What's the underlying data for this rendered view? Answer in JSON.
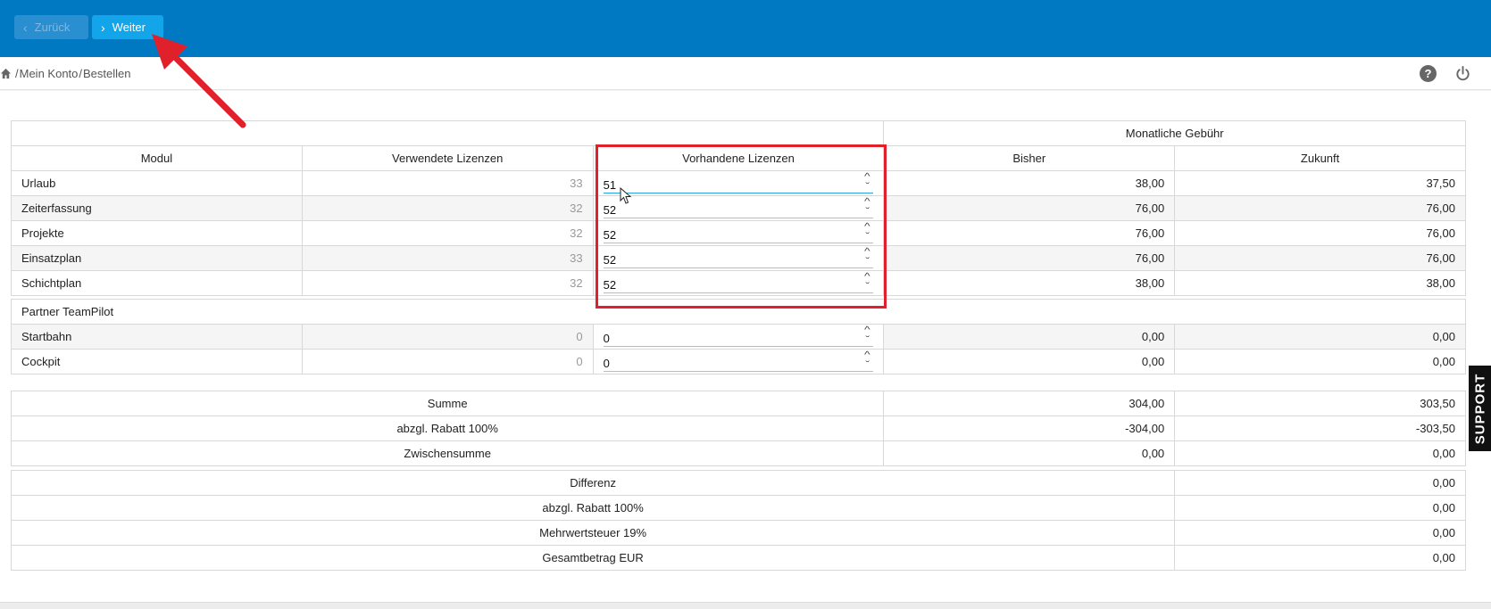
{
  "toolbar": {
    "back_label": "Zurück",
    "next_label": "Weiter"
  },
  "breadcrumb": {
    "items": [
      "Mein Konto",
      "Bestellen"
    ],
    "separator": "/"
  },
  "table": {
    "group_header": "Monatliche Gebühr",
    "headers": {
      "module": "Modul",
      "used": "Verwendete Lizenzen",
      "available": "Vorhandene Lizenzen",
      "previous": "Bisher",
      "future": "Zukunft"
    },
    "rows": [
      {
        "module": "Urlaub",
        "used": "33",
        "available": "51",
        "previous": "38,00",
        "future": "37,50"
      },
      {
        "module": "Zeiterfassung",
        "used": "32",
        "available": "52",
        "previous": "76,00",
        "future": "76,00"
      },
      {
        "module": "Projekte",
        "used": "32",
        "available": "52",
        "previous": "76,00",
        "future": "76,00"
      },
      {
        "module": "Einsatzplan",
        "used": "33",
        "available": "52",
        "previous": "76,00",
        "future": "76,00"
      },
      {
        "module": "Schichtplan",
        "used": "32",
        "available": "52",
        "previous": "38,00",
        "future": "38,00"
      }
    ],
    "partner_label": "Partner TeamPilot",
    "partner_rows": [
      {
        "module": "Startbahn",
        "used": "0",
        "available": "0",
        "previous": "0,00",
        "future": "0,00"
      },
      {
        "module": "Cockpit",
        "used": "0",
        "available": "0",
        "previous": "0,00",
        "future": "0,00"
      }
    ]
  },
  "summary": {
    "rows": [
      {
        "label": "Summe",
        "previous": "304,00",
        "future": "303,50"
      },
      {
        "label": "abzgl. Rabatt 100%",
        "previous": "-304,00",
        "future": "-303,50"
      },
      {
        "label": "Zwischensumme",
        "previous": "0,00",
        "future": "0,00"
      }
    ]
  },
  "final": {
    "rows": [
      {
        "label": "Differenz",
        "value": "0,00"
      },
      {
        "label": "abzgl. Rabatt 100%",
        "value": "0,00"
      },
      {
        "label": "Mehrwertsteuer 19%",
        "value": "0,00"
      },
      {
        "label": "Gesamtbetrag EUR",
        "value": "0,00"
      }
    ]
  },
  "support_label": "SUPPORT",
  "icons": {
    "home": "home-icon",
    "help": "help-icon",
    "power": "power-icon",
    "back": "chevron-left-icon",
    "next": "chevron-right-icon"
  },
  "colors": {
    "topbar": "#0078c2",
    "next_button": "#12a5ea",
    "highlight": "#e0202a",
    "arrow": "#e0202a"
  }
}
